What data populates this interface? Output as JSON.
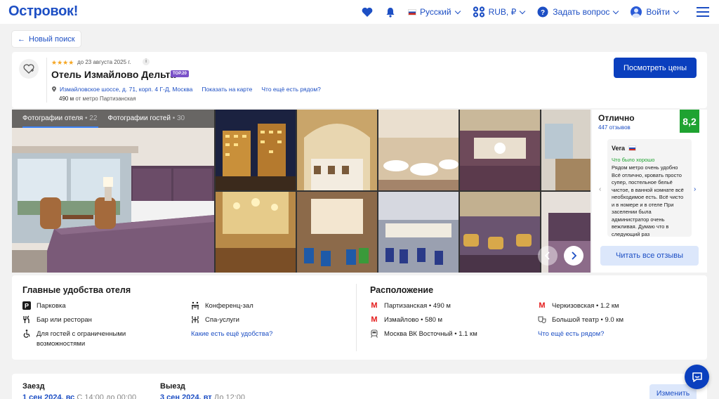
{
  "header": {
    "logo": "Островок!",
    "language": "Русский",
    "currency": "RUB, ₽",
    "help": "Задать вопрос",
    "login": "Войти"
  },
  "new_search": "Новый поиск",
  "hotel": {
    "stars": "★★★★",
    "until": "до 23 августа 2025 г.",
    "name": "Отель Измайлово Дельта",
    "badge": "TOP.20",
    "address": "Измайловское шоссе, д. 71, корп. 4 Г-Д, Москва",
    "show_on_map": "Показать на карте",
    "nearby": "Что ещё есть рядом?",
    "metro_distance": "490 м",
    "metro_text": "от метро Партизанская",
    "view_prices": "Посмотреть цены"
  },
  "gallery": {
    "tabs": [
      {
        "label": "Фотографии отеля",
        "count": "22"
      },
      {
        "label": "Фотографии гостей",
        "count": "30"
      }
    ]
  },
  "rating": {
    "label": "Отлично",
    "count": "447 отзывов",
    "score": "8,2",
    "review": {
      "author": "Vera",
      "good_label": "Что было хорошо",
      "text": "Рядом метро очень удобно Всё отлично, кровать просто супер, постельное бельё чистое, в ванной комнате всё необходимое есть. Всё чисто и в номере и в отеле При заселении была администратор очень вежливая. Думаю что в следующий раз"
    },
    "all_reviews": "Читать все отзывы"
  },
  "amenities": {
    "title": "Главные удобства отеля",
    "items": [
      {
        "label": "Парковка",
        "icon": "parking-icon"
      },
      {
        "label": "Бар или ресторан",
        "icon": "restaurant-icon"
      },
      {
        "label": "Для гостей с ограниченными возможностями",
        "icon": "accessibility-icon"
      },
      {
        "label": "Конференц-зал",
        "icon": "conference-icon"
      },
      {
        "label": "Спа-услуги",
        "icon": "spa-icon"
      }
    ],
    "more_link": "Какие есть ещё удобства?"
  },
  "location": {
    "title": "Расположение",
    "items": [
      {
        "label": "Партизанская • 490 м",
        "icon": "metro-icon"
      },
      {
        "label": "Измайлово • 580 м",
        "icon": "metro-icon"
      },
      {
        "label": "Москва ВК Восточный • 1.1 км",
        "icon": "train-icon"
      },
      {
        "label": "Черкизовская • 1.2 км",
        "icon": "metro-icon"
      },
      {
        "label": "Большой театр • 9.0 км",
        "icon": "theater-icon"
      }
    ],
    "more_link": "Что ещё есть рядом?"
  },
  "dates": {
    "checkin_label": "Заезд",
    "checkin_date": "1 сен 2024, вс",
    "checkin_time": "С 14:00 до 00:00",
    "checkout_label": "Выезд",
    "checkout_date": "3 сен 2024, вт",
    "checkout_time": "До 12:00",
    "change": "Изменить"
  },
  "colors": {
    "brand_blue": "#1d4fc4",
    "button_blue": "#0a3fbe",
    "score_green": "#1fa331",
    "badge_purple": "#7b52c9",
    "metro_red": "#e41b1b"
  }
}
